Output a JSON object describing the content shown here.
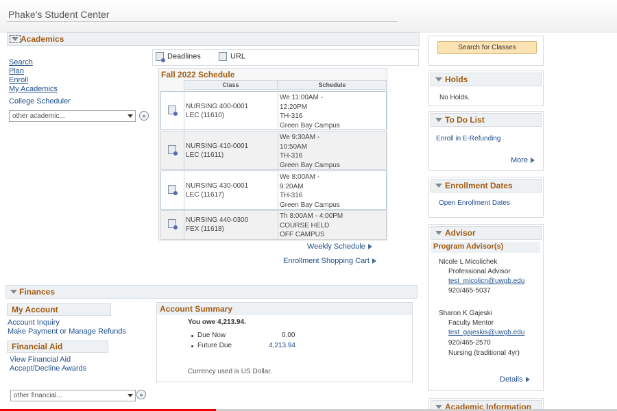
{
  "page": {
    "title": "Phake's Student Center"
  },
  "academics": {
    "header": "Academics",
    "links": [
      "Search",
      "Plan",
      "Enroll",
      "My Academics"
    ],
    "college_scheduler": "College Scheduler",
    "select_value": "other academic...",
    "go_label": "»"
  },
  "toolbar": {
    "deadlines": "Deadlines",
    "url": "URL"
  },
  "schedule": {
    "title": "Fall 2022 Schedule",
    "col_class": "Class",
    "col_schedule": "Schedule",
    "rows": [
      {
        "course": "NURSING 400-0001",
        "section": "LEC (11610)",
        "l1": "We 11:00AM -",
        "l2": "12:20PM",
        "l3": "TH-316",
        "l4": "Green Bay Campus"
      },
      {
        "course": "NURSING 410-0001",
        "section": "LEC (11611)",
        "l1": "We 9:30AM -",
        "l2": "10:50AM",
        "l3": "TH-316",
        "l4": "Green Bay Campus"
      },
      {
        "course": "NURSING 430-0001",
        "section": "LEC (11617)",
        "l1": "We 8:00AM -",
        "l2": "9:20AM",
        "l3": "TH-316",
        "l4": "Green Bay Campus"
      },
      {
        "course": "NURSING 440-0300",
        "section": "FEX (11618)",
        "l1": "Th 8:00AM - 4:00PM",
        "l2": "COURSE HELD",
        "l3": "OFF CAMPUS",
        "l4": ""
      }
    ],
    "weekly_link": "Weekly Schedule",
    "cart_link": "Enrollment Shopping Cart"
  },
  "finances": {
    "header": "Finances",
    "my_account": "My Account",
    "account_inquiry": "Account Inquiry",
    "make_payment": "Make Payment or Manage Refunds",
    "financial_aid": "Financial Aid",
    "view_aid": "View Financial Aid",
    "accept_decline": "Accept/Decline Awards",
    "select_value": "other financial...",
    "go_label": "»"
  },
  "account_summary": {
    "header": "Account Summary",
    "you_owe": "You owe 4,213.94.",
    "due_now_label": "Due Now",
    "due_now_value": "0.00",
    "future_due_label": "Future Due",
    "future_due_value": "4,213.94",
    "currency_note": "Currency used is US Dollar."
  },
  "right": {
    "search_button": "Search for Classes",
    "holds_header": "Holds",
    "holds_text": "No Holds.",
    "todo_header": "To Do List",
    "todo_item": "Enroll in E-Refunding",
    "todo_more": "More",
    "enroll_dates_header": "Enrollment Dates",
    "enroll_dates_link": "Open Enrollment Dates",
    "advisor_header": "Advisor",
    "program_advisors": "Program Advisor(s)",
    "advisors": [
      {
        "name": "Nicole L Micolichek",
        "role": "Professional Advisor",
        "email": "test_micolicn@uwgb.edu",
        "phone": "920/465-5037"
      },
      {
        "name": "Sharon K Gajeski",
        "role": "Faculty Mentor",
        "email": "test_gajeskis@uwgb.edu",
        "phone": "920/465-2570",
        "extra": "Nursing (traditional 4yr)"
      }
    ],
    "details_link": "Details",
    "academic_info_header": "Academic Information"
  },
  "video": {
    "progress": 0.35
  }
}
